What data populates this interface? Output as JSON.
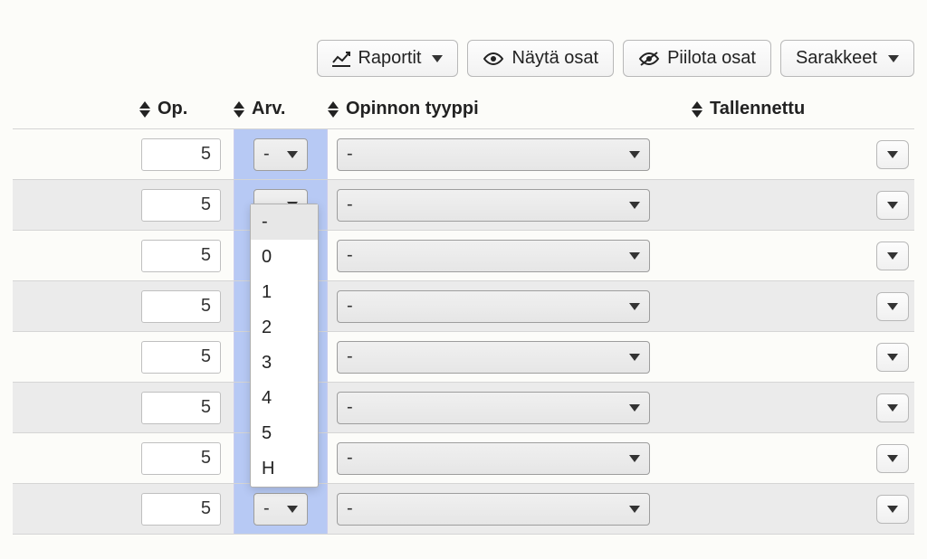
{
  "toolbar": {
    "reports_label": "Raportit",
    "show_parts_label": "Näytä osat",
    "hide_parts_label": "Piilota osat",
    "columns_label": "Sarakkeet"
  },
  "columns": {
    "op": "Op.",
    "arv": "Arv.",
    "type": "Opinnon tyyppi",
    "saved": "Tallennettu"
  },
  "arv_dropdown": {
    "open_row_index": 0,
    "options": [
      "-",
      "0",
      "1",
      "2",
      "3",
      "4",
      "5",
      "H"
    ]
  },
  "rows": [
    {
      "op": "5",
      "arv": "-",
      "type": "-"
    },
    {
      "op": "5",
      "arv": "-",
      "type": "-"
    },
    {
      "op": "5",
      "arv": "-",
      "type": "-"
    },
    {
      "op": "5",
      "arv": "-",
      "type": "-"
    },
    {
      "op": "5",
      "arv": "-",
      "type": "-"
    },
    {
      "op": "5",
      "arv": "-",
      "type": "-"
    },
    {
      "op": "5",
      "arv": "-",
      "type": "-"
    },
    {
      "op": "5",
      "arv": "-",
      "type": "-"
    }
  ]
}
